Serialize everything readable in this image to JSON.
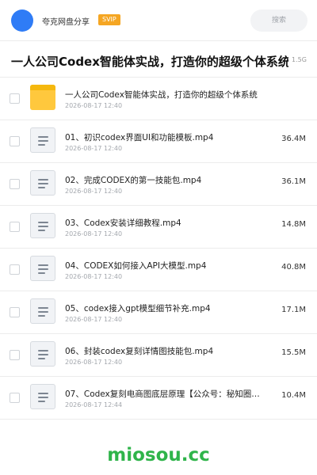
{
  "header": {
    "share_name": "夸克网盘分享",
    "badge": "SVIP",
    "search_placeholder": "搜索"
  },
  "folder": {
    "title": "一人公司Codex智能体实战，打造你的超级个体系统",
    "size": "1.5G"
  },
  "files": [
    {
      "icon": "folder-icon",
      "name": "一人公司Codex智能体实战，打造你的超级个体系统",
      "date": "2026-08-17 12:40",
      "size": ""
    },
    {
      "icon": "document-icon",
      "name": "01、初识codex界面UI和功能模板.mp4",
      "date": "2026-08-17 12:40",
      "size": "36.4M"
    },
    {
      "icon": "document-icon",
      "name": "02、完成CODEX的第一技能包.mp4",
      "date": "2026-08-17 12:40",
      "size": "36.1M"
    },
    {
      "icon": "document-icon",
      "name": "03、Codex安装详细教程.mp4",
      "date": "2026-08-17 12:40",
      "size": "14.8M"
    },
    {
      "icon": "document-icon",
      "name": "04、CODEX如何接入API大模型.mp4",
      "date": "2026-08-17 12:40",
      "size": "40.8M"
    },
    {
      "icon": "document-icon",
      "name": "05、codex接入gpt模型细节补充.mp4",
      "date": "2026-08-17 12:40",
      "size": "17.1M"
    },
    {
      "icon": "document-icon",
      "name": "06、封装codex复刻详情图技能包.mp4",
      "date": "2026-08-17 12:40",
      "size": "15.5M"
    },
    {
      "icon": "document-icon",
      "name": "07、Codex复刻电商图底层原理【公众号：秘知圈…",
      "date": "2026-08-17 12:44",
      "size": "10.4M"
    }
  ],
  "watermark": "miosou.cc",
  "colors": {
    "accent": "#2f7cf6",
    "svip": "#f5a623",
    "folder": "#ffc83d",
    "watermark": "#2fb44a"
  }
}
